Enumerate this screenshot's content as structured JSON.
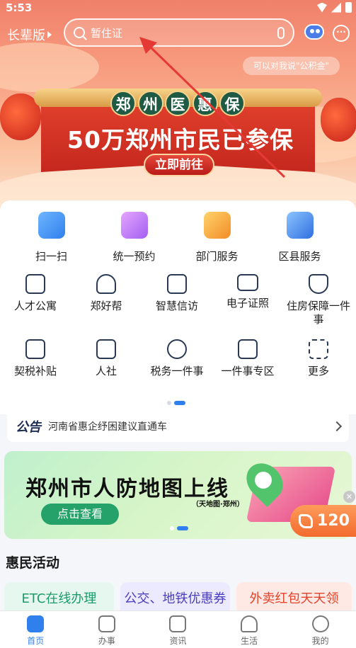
{
  "status_bar": {
    "time": "5:53",
    "icons": [
      "wifi-icon",
      "signal-icon",
      "battery-icon"
    ]
  },
  "header": {
    "mode_label": "长辈版",
    "search_placeholder": "暂住证",
    "assistant_tip": "可以对我说\"公积金\"",
    "more_label": "···"
  },
  "banner": {
    "title_chars": [
      "郑",
      "州",
      "医",
      "惠",
      "保"
    ],
    "headline": "50万郑州市民已参保",
    "button": "立即前往"
  },
  "primary_services": [
    {
      "label": "扫一扫",
      "icon": "scan-icon",
      "color": "#3d8ff5"
    },
    {
      "label": "统一预约",
      "icon": "calendar-card-icon",
      "color": "#b56ef0"
    },
    {
      "label": "部门服务",
      "icon": "folder-star-icon",
      "color": "#f6a93a"
    },
    {
      "label": "区县服务",
      "icon": "building-docs-icon",
      "color": "#2f80ed"
    }
  ],
  "service_rows": [
    [
      {
        "label": "人才公寓",
        "icon": "apartment-icon"
      },
      {
        "label": "郑好帮",
        "icon": "heart-hand-icon"
      },
      {
        "label": "智慧信访",
        "icon": "letter-chart-icon"
      },
      {
        "label": "电子证照",
        "icon": "id-card-icon"
      },
      {
        "label": "住房保障一件事",
        "icon": "house-shield-icon"
      }
    ],
    [
      {
        "label": "契税补贴",
        "icon": "document-icon"
      },
      {
        "label": "人社",
        "icon": "person-id-icon"
      },
      {
        "label": "税务一件事",
        "icon": "tax-hand-icon"
      },
      {
        "label": "一件事专区",
        "icon": "overlap-squares-icon"
      },
      {
        "label": "更多",
        "icon": "grid-more-icon"
      }
    ]
  ],
  "notice": {
    "tag": "公告",
    "text": "河南省惠企纾困建议直通车"
  },
  "promo": {
    "title": "郑州市人防地图上线",
    "subtitle": "（天地图·郑州）",
    "button": "点击查看"
  },
  "hotline": {
    "number": "120"
  },
  "section_title": "惠民活动",
  "activities": [
    {
      "label": "ETC在线办理",
      "bg": "#e6f7ef",
      "color": "#1d9b6a"
    },
    {
      "label": "公交、地铁优惠券",
      "bg": "#eceaff",
      "color": "#4b3fbf"
    },
    {
      "label": "外卖红包天天领",
      "bg": "#ffe9e4",
      "color": "#e0452c"
    }
  ],
  "tabbar": [
    {
      "label": "首页",
      "icon": "home-icon",
      "active": true
    },
    {
      "label": "办事",
      "icon": "clock-icon",
      "active": false
    },
    {
      "label": "资讯",
      "icon": "news-icon",
      "active": false
    },
    {
      "label": "生活",
      "icon": "heart-icon",
      "active": false
    },
    {
      "label": "我的",
      "icon": "user-icon",
      "active": false
    }
  ],
  "colors": {
    "accent": "#2f80ed",
    "annotation_arrow": "#e53935"
  }
}
